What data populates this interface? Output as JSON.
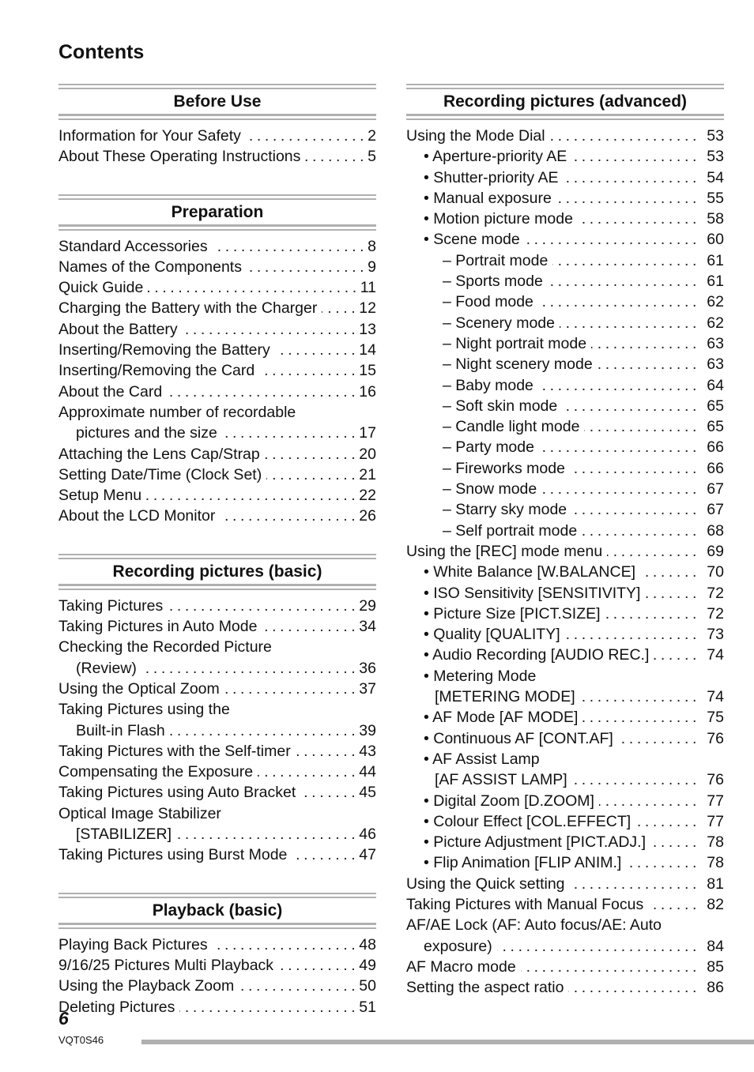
{
  "title": "Contents",
  "left_sections": [
    {
      "heading": "Before Use",
      "items": [
        {
          "label": "Information for Your Safety",
          "page": "2",
          "indent": 0
        },
        {
          "label": "About These Operating Instructions",
          "page": "5",
          "indent": 0
        }
      ]
    },
    {
      "heading": "Preparation",
      "items": [
        {
          "label": "Standard Accessories",
          "page": "8",
          "indent": 0
        },
        {
          "label": "Names of the Components",
          "page": "9",
          "indent": 0
        },
        {
          "label": "Quick Guide",
          "page": "11",
          "indent": 0
        },
        {
          "label": "Charging the Battery with the Charger",
          "page": "12",
          "indent": 0
        },
        {
          "label": "About the Battery",
          "page": "13",
          "indent": 0
        },
        {
          "label": "Inserting/Removing the Battery",
          "page": "14",
          "indent": 0
        },
        {
          "label": "Inserting/Removing the Card",
          "page": "15",
          "indent": 0
        },
        {
          "label": "About the Card",
          "page": "16",
          "indent": 0
        },
        {
          "label": "Approximate number of recordable",
          "page": "",
          "indent": 0
        },
        {
          "label": "pictures and the size",
          "page": "17",
          "indent": 1
        },
        {
          "label": "Attaching the Lens Cap/Strap",
          "page": "20",
          "indent": 0
        },
        {
          "label": "Setting Date/Time (Clock Set)",
          "page": "21",
          "indent": 0
        },
        {
          "label": "Setup Menu",
          "page": "22",
          "indent": 0
        },
        {
          "label": "About the LCD Monitor",
          "page": "26",
          "indent": 0
        }
      ]
    },
    {
      "heading": "Recording pictures (basic)",
      "items": [
        {
          "label": "Taking Pictures",
          "page": "29",
          "indent": 0
        },
        {
          "label": "Taking Pictures in Auto Mode",
          "page": "34",
          "indent": 0
        },
        {
          "label": "Checking the Recorded Picture",
          "page": "",
          "indent": 0
        },
        {
          "label": "(Review)",
          "page": "36",
          "indent": 1
        },
        {
          "label": "Using the Optical Zoom",
          "page": "37",
          "indent": 0
        },
        {
          "label": "Taking Pictures using the",
          "page": "",
          "indent": 0
        },
        {
          "label": "Built-in Flash",
          "page": "39",
          "indent": 1
        },
        {
          "label": "Taking Pictures with the Self-timer",
          "page": "43",
          "indent": 0
        },
        {
          "label": "Compensating the Exposure",
          "page": "44",
          "indent": 0
        },
        {
          "label": "Taking Pictures using Auto Bracket",
          "page": "45",
          "indent": 0
        },
        {
          "label": "Optical Image Stabilizer",
          "page": "",
          "indent": 0
        },
        {
          "label": "[STABILIZER]",
          "page": "46",
          "indent": 1
        },
        {
          "label": "Taking Pictures using Burst Mode",
          "page": "47",
          "indent": 0
        }
      ]
    },
    {
      "heading": "Playback (basic)",
      "items": [
        {
          "label": "Playing Back Pictures",
          "page": "48",
          "indent": 0
        },
        {
          "label": "9/16/25 Pictures Multi Playback",
          "page": "49",
          "indent": 0
        },
        {
          "label": "Using the Playback Zoom",
          "page": "50",
          "indent": 0
        },
        {
          "label": "Deleting Pictures",
          "page": "51",
          "indent": 0
        }
      ]
    }
  ],
  "right_sections": [
    {
      "heading": "Recording pictures (advanced)",
      "items": [
        {
          "label": "Using the Mode Dial",
          "page": "53",
          "indent": 0
        },
        {
          "label": "• Aperture-priority AE",
          "page": "53",
          "indent": 1
        },
        {
          "label": "• Shutter-priority AE",
          "page": "54",
          "indent": 1
        },
        {
          "label": "• Manual exposure",
          "page": "55",
          "indent": 1
        },
        {
          "label": "• Motion picture mode",
          "page": "58",
          "indent": 1
        },
        {
          "label": "• Scene mode",
          "page": "60",
          "indent": 1
        },
        {
          "label": "– Portrait mode",
          "page": "61",
          "indent": 2
        },
        {
          "label": "– Sports mode",
          "page": "61",
          "indent": 2
        },
        {
          "label": "– Food mode",
          "page": "62",
          "indent": 2
        },
        {
          "label": "– Scenery mode",
          "page": "62",
          "indent": 2
        },
        {
          "label": "– Night portrait mode",
          "page": "63",
          "indent": 2
        },
        {
          "label": "– Night scenery mode",
          "page": "63",
          "indent": 2
        },
        {
          "label": "– Baby mode",
          "page": "64",
          "indent": 2
        },
        {
          "label": "– Soft skin mode",
          "page": "65",
          "indent": 2
        },
        {
          "label": "– Candle light mode",
          "page": "65",
          "indent": 2
        },
        {
          "label": "– Party mode",
          "page": "66",
          "indent": 2
        },
        {
          "label": "– Fireworks mode",
          "page": "66",
          "indent": 2
        },
        {
          "label": "– Snow mode",
          "page": "67",
          "indent": 2
        },
        {
          "label": "– Starry sky mode",
          "page": "67",
          "indent": 2
        },
        {
          "label": "– Self portrait mode",
          "page": "68",
          "indent": 2
        },
        {
          "label": "Using the [REC] mode menu",
          "page": "69",
          "indent": 0
        },
        {
          "label": "• White Balance [W.BALANCE]",
          "page": "70",
          "indent": 1
        },
        {
          "label": "• ISO Sensitivity [SENSITIVITY]",
          "page": "72",
          "indent": 1
        },
        {
          "label": "• Picture Size [PICT.SIZE]",
          "page": "72",
          "indent": 1
        },
        {
          "label": "• Quality [QUALITY]",
          "page": "73",
          "indent": 1
        },
        {
          "label": "• Audio Recording [AUDIO REC.]",
          "page": "74",
          "indent": 1
        },
        {
          "label": "• Metering Mode",
          "page": "",
          "indent": 1
        },
        {
          "label": "[METERING MODE]",
          "page": "74",
          "indent": 3
        },
        {
          "label": "• AF Mode [AF MODE]",
          "page": "75",
          "indent": 1
        },
        {
          "label": "• Continuous AF [CONT.AF]",
          "page": "76",
          "indent": 1
        },
        {
          "label": "• AF Assist Lamp",
          "page": "",
          "indent": 1
        },
        {
          "label": "[AF ASSIST LAMP]",
          "page": "76",
          "indent": 3
        },
        {
          "label": "• Digital Zoom [D.ZOOM]",
          "page": "77",
          "indent": 1
        },
        {
          "label": "• Colour Effect [COL.EFFECT]",
          "page": "77",
          "indent": 1
        },
        {
          "label": "• Picture Adjustment [PICT.ADJ.]",
          "page": "78",
          "indent": 1
        },
        {
          "label": "• Flip Animation [FLIP ANIM.]",
          "page": "78",
          "indent": 1
        },
        {
          "label": "Using the Quick setting",
          "page": "81",
          "indent": 0
        },
        {
          "label": "Taking Pictures with Manual Focus",
          "page": "82",
          "indent": 0
        },
        {
          "label": "AF/AE Lock (AF: Auto focus/AE: Auto",
          "page": "",
          "indent": 0
        },
        {
          "label": "exposure)",
          "page": "84",
          "indent": 4
        },
        {
          "label": "AF Macro mode",
          "page": "85",
          "indent": 0
        },
        {
          "label": "Setting the aspect ratio",
          "page": "86",
          "indent": 0
        }
      ]
    }
  ],
  "footer": {
    "page_number": "6",
    "document_code": "VQT0S46"
  },
  "colors": {
    "rule_gray": "#b0b0b0",
    "text": "#111111"
  }
}
